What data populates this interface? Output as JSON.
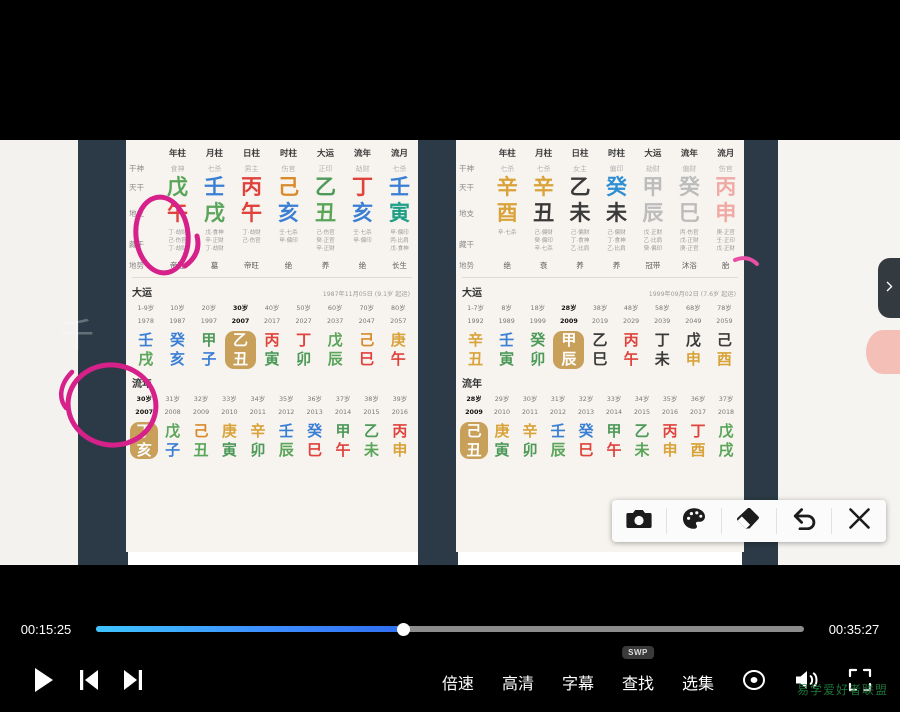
{
  "player": {
    "current_time": "00:15:25",
    "total_time": "00:35:27",
    "progress_percent": 43.5,
    "accent_color": "#3d8bff",
    "controls": {
      "play_label": "play-icon",
      "prev_label": "previous-icon",
      "next_label": "next-icon",
      "speed": "倍速",
      "quality": "高清",
      "subtitle": "字幕",
      "search": "查找",
      "playlist": "选集",
      "swp_badge": "SWP",
      "cast_icon": "cast-icon",
      "volume_icon": "volume-icon",
      "fullscreen_icon": "fullscreen-icon"
    }
  },
  "watermarks": {
    "video_watermark": "千",
    "site_watermark": "易学爱好者联盟"
  },
  "drawer": {
    "tab_icon": "chevron-right-icon"
  },
  "draw_toolbar": {
    "items": [
      {
        "name": "screenshot",
        "icon": "camera-icon"
      },
      {
        "name": "palette",
        "icon": "palette-icon"
      },
      {
        "name": "eraser",
        "icon": "eraser-icon"
      },
      {
        "name": "undo",
        "icon": "undo-icon"
      },
      {
        "name": "close",
        "icon": "close-icon"
      }
    ]
  },
  "charts": [
    {
      "id": "left",
      "columns": [
        "年柱",
        "月柱",
        "日柱",
        "时柱",
        "大运",
        "流年",
        "流月"
      ],
      "rows": {
        "shen_label": "干神",
        "shen": [
          "食神",
          "七杀",
          "男主",
          "伤官",
          "正印",
          "劫财",
          "七杀"
        ],
        "gan_label": "天干",
        "gan": [
          {
            "c": "戊",
            "color": "#5aa55a"
          },
          {
            "c": "壬",
            "color": "#3b7fd4"
          },
          {
            "c": "丙",
            "color": "#e0423c"
          },
          {
            "c": "己",
            "color": "#d98b2b"
          },
          {
            "c": "乙",
            "color": "#4e9a5a"
          },
          {
            "c": "丁",
            "color": "#e0423c"
          },
          {
            "c": "壬",
            "color": "#3b7fd4"
          }
        ],
        "zhi_label": "地支",
        "zhi": [
          {
            "c": "午",
            "color": "#e0423c"
          },
          {
            "c": "戌",
            "color": "#5aa55a"
          },
          {
            "c": "午",
            "color": "#e0423c"
          },
          {
            "c": "亥",
            "color": "#3b7fd4"
          },
          {
            "c": "丑",
            "color": "#5aa55a"
          },
          {
            "c": "亥",
            "color": "#3b7fd4"
          },
          {
            "c": "寅",
            "color": "#1f9e86"
          }
        ],
        "canggan_label": "藏干",
        "canggan": [
          "丁·劫财\n己·伤官\n丁·劫财",
          "戊·食神\n辛·正财\n丁·劫财",
          "丁·劫财\n己·伤官",
          "壬·七杀\n甲·偏印",
          "己·伤官\n癸·正官\n辛·正财",
          "壬·七杀\n甲·偏印",
          "甲·偏印\n丙·比肩\n戊·食神"
        ],
        "dishi_label": "地势",
        "dishi": [
          "帝旺",
          "墓",
          "帝旺",
          "绝",
          "养",
          "绝",
          "长生"
        ]
      },
      "dayun": {
        "title": "大运",
        "note": "1987年11月05日 (9.1岁 起运)",
        "ages": [
          "1-9岁",
          "10岁",
          "20岁",
          "30岁",
          "40岁",
          "50岁",
          "60岁",
          "70岁",
          "80岁"
        ],
        "years": [
          "1978",
          "1987",
          "1997",
          "2007",
          "2017",
          "2027",
          "2037",
          "2047",
          "2057"
        ],
        "current_index": 3,
        "pillars": [
          {
            "gan": "壬",
            "zhi": "戌",
            "gc": "#3b7fd4",
            "zc": "#5aa55a"
          },
          {
            "gan": "癸",
            "zhi": "亥",
            "gc": "#3b7fd4",
            "zc": "#3b7fd4"
          },
          {
            "gan": "甲",
            "zhi": "子",
            "gc": "#4e9a5a",
            "zc": "#3b7fd4"
          },
          {
            "gan": "乙",
            "zhi": "丑",
            "gc": "#ffffff",
            "zc": "#ffffff"
          },
          {
            "gan": "丙",
            "zhi": "寅",
            "gc": "#e0423c",
            "zc": "#4e9a5a"
          },
          {
            "gan": "丁",
            "zhi": "卯",
            "gc": "#e0423c",
            "zc": "#4e9a5a"
          },
          {
            "gan": "戊",
            "zhi": "辰",
            "gc": "#5aa55a",
            "zc": "#5aa55a"
          },
          {
            "gan": "己",
            "zhi": "巳",
            "gc": "#d98b2b",
            "zc": "#e0423c"
          },
          {
            "gan": "庚",
            "zhi": "午",
            "gc": "#d9a33a",
            "zc": "#e0423c"
          }
        ]
      },
      "liunian": {
        "title": "流年",
        "ages": [
          "30岁",
          "31岁",
          "32岁",
          "33岁",
          "34岁",
          "35岁",
          "36岁",
          "37岁",
          "38岁",
          "39岁"
        ],
        "years": [
          "2007",
          "2008",
          "2009",
          "2010",
          "2011",
          "2012",
          "2013",
          "2014",
          "2015",
          "2016"
        ],
        "current_index": 0,
        "pillars": [
          {
            "gan": "丁",
            "zhi": "亥",
            "gc": "#ffffff",
            "zc": "#ffffff"
          },
          {
            "gan": "戊",
            "zhi": "子",
            "gc": "#5aa55a",
            "zc": "#3b7fd4"
          },
          {
            "gan": "己",
            "zhi": "丑",
            "gc": "#d98b2b",
            "zc": "#5aa55a"
          },
          {
            "gan": "庚",
            "zhi": "寅",
            "gc": "#d9a33a",
            "zc": "#4e9a5a"
          },
          {
            "gan": "辛",
            "zhi": "卯",
            "gc": "#d9a33a",
            "zc": "#4e9a5a"
          },
          {
            "gan": "壬",
            "zhi": "辰",
            "gc": "#3b7fd4",
            "zc": "#5aa55a"
          },
          {
            "gan": "癸",
            "zhi": "巳",
            "gc": "#3b7fd4",
            "zc": "#e0423c"
          },
          {
            "gan": "甲",
            "zhi": "午",
            "gc": "#4e9a5a",
            "zc": "#e0423c"
          },
          {
            "gan": "乙",
            "zhi": "未",
            "gc": "#4e9a5a",
            "zc": "#5aa55a"
          },
          {
            "gan": "丙",
            "zhi": "申",
            "gc": "#e0423c",
            "zc": "#d9a33a"
          }
        ]
      }
    },
    {
      "id": "right",
      "columns": [
        "年柱",
        "月柱",
        "日柱",
        "时柱",
        "大运",
        "流年",
        "流月"
      ],
      "rows": {
        "shen_label": "干神",
        "shen": [
          "七杀",
          "七杀",
          "女主",
          "偏印",
          "劫财",
          "偏财",
          "伤官"
        ],
        "gan_label": "天干",
        "gan": [
          {
            "c": "辛",
            "color": "#d9a33a"
          },
          {
            "c": "辛",
            "color": "#d9a33a"
          },
          {
            "c": "乙",
            "color": "#3a3a3a"
          },
          {
            "c": "癸",
            "color": "#2f8fd4"
          },
          {
            "c": "甲",
            "color": "#bcbcbc"
          },
          {
            "c": "癸",
            "color": "#bcbcbc"
          },
          {
            "c": "丙",
            "color": "#f0a9a4"
          }
        ],
        "zhi_label": "地支",
        "zhi": [
          {
            "c": "酉",
            "color": "#d9a33a"
          },
          {
            "c": "丑",
            "color": "#3a3a3a"
          },
          {
            "c": "未",
            "color": "#3a3a3a"
          },
          {
            "c": "未",
            "color": "#3a3a3a"
          },
          {
            "c": "辰",
            "color": "#bcbcbc"
          },
          {
            "c": "巳",
            "color": "#bcbcbc"
          },
          {
            "c": "申",
            "color": "#f0a9a4"
          }
        ],
        "canggan_label": "藏干",
        "canggan": [
          "辛·七杀",
          "己·偏财\n癸·偏印\n辛·七杀",
          "己·偏财\n丁·食神\n乙·比肩",
          "己·偏财\n丁·食神\n乙·比肩",
          "戊·正财\n乙·比肩\n癸·偏印",
          "丙·伤官\n戊·正财\n庚·正官",
          "庚·正官\n壬·正印\n戊·正财"
        ],
        "dishi_label": "地势",
        "dishi": [
          "绝",
          "衰",
          "养",
          "养",
          "冠带",
          "沐浴",
          "胎"
        ]
      },
      "dayun": {
        "title": "大运",
        "note": "1999年09月02日 (7.6岁 起运)",
        "ages": [
          "1-7岁",
          "8岁",
          "18岁",
          "28岁",
          "38岁",
          "48岁",
          "58岁",
          "68岁",
          "78岁"
        ],
        "years": [
          "1992",
          "1989",
          "1999",
          "2009",
          "2019",
          "2029",
          "2039",
          "2049",
          "2059"
        ],
        "current_index": 3,
        "pillars": [
          {
            "gan": "辛",
            "zhi": "丑",
            "gc": "#d9a33a",
            "zc": "#d9a33a"
          },
          {
            "gan": "壬",
            "zhi": "寅",
            "gc": "#3b7fd4",
            "zc": "#4e9a5a"
          },
          {
            "gan": "癸",
            "zhi": "卯",
            "gc": "#4e9a5a",
            "zc": "#4e9a5a"
          },
          {
            "gan": "甲",
            "zhi": "辰",
            "gc": "#ffffff",
            "zc": "#ffffff"
          },
          {
            "gan": "乙",
            "zhi": "巳",
            "gc": "#3a3a3a",
            "zc": "#3a3a3a"
          },
          {
            "gan": "丙",
            "zhi": "午",
            "gc": "#e0423c",
            "zc": "#e0423c"
          },
          {
            "gan": "丁",
            "zhi": "未",
            "gc": "#3a3a3a",
            "zc": "#3a3a3a"
          },
          {
            "gan": "戊",
            "zhi": "申",
            "gc": "#3a3a3a",
            "zc": "#d9a33a"
          },
          {
            "gan": "己",
            "zhi": "酉",
            "gc": "#3a3a3a",
            "zc": "#d9a33a"
          }
        ]
      },
      "liunian": {
        "title": "流年",
        "ages": [
          "28岁",
          "29岁",
          "30岁",
          "31岁",
          "32岁",
          "33岁",
          "34岁",
          "35岁",
          "36岁",
          "37岁"
        ],
        "years": [
          "2009",
          "2010",
          "2011",
          "2012",
          "2013",
          "2014",
          "2015",
          "2016",
          "2017",
          "2018"
        ],
        "current_index": 0,
        "pillars": [
          {
            "gan": "己",
            "zhi": "丑",
            "gc": "#ffffff",
            "zc": "#ffffff"
          },
          {
            "gan": "庚",
            "zhi": "寅",
            "gc": "#d9a33a",
            "zc": "#4e9a5a"
          },
          {
            "gan": "辛",
            "zhi": "卯",
            "gc": "#d9a33a",
            "zc": "#4e9a5a"
          },
          {
            "gan": "壬",
            "zhi": "辰",
            "gc": "#3b7fd4",
            "zc": "#5aa55a"
          },
          {
            "gan": "癸",
            "zhi": "巳",
            "gc": "#3b7fd4",
            "zc": "#e0423c"
          },
          {
            "gan": "甲",
            "zhi": "午",
            "gc": "#4e9a5a",
            "zc": "#e0423c"
          },
          {
            "gan": "乙",
            "zhi": "未",
            "gc": "#4e9a5a",
            "zc": "#5aa55a"
          },
          {
            "gan": "丙",
            "zhi": "申",
            "gc": "#e0423c",
            "zc": "#d9a33a"
          },
          {
            "gan": "丁",
            "zhi": "酉",
            "gc": "#e0423c",
            "zc": "#d9a33a"
          },
          {
            "gan": "戊",
            "zhi": "戌",
            "gc": "#5aa55a",
            "zc": "#5aa55a"
          }
        ]
      }
    }
  ],
  "annotations": {
    "ink_color": "#d6218a",
    "marks": [
      "circle-over-shi-zhu-hai",
      "circle-over-dayun-yichou"
    ]
  }
}
